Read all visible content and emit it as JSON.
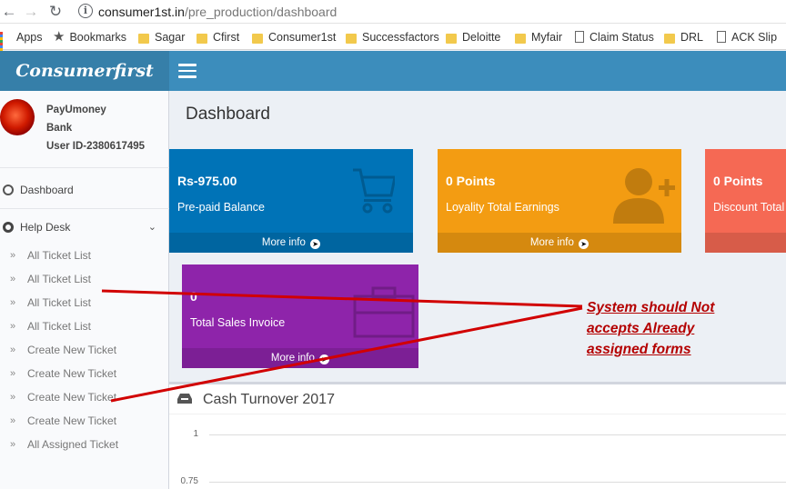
{
  "browser": {
    "url_host": "consumer1st.in",
    "url_path": "/pre_production/dashboard",
    "bookmarks": [
      {
        "label": "Apps",
        "icon": "apps-grid-icon"
      },
      {
        "label": "Bookmarks",
        "icon": "star-icon"
      },
      {
        "label": "Sagar",
        "icon": "folder-icon"
      },
      {
        "label": "Cfirst",
        "icon": "folder-icon"
      },
      {
        "label": "Consumer1st",
        "icon": "folder-icon"
      },
      {
        "label": "Successfactors",
        "icon": "folder-icon"
      },
      {
        "label": "Deloitte",
        "icon": "folder-icon"
      },
      {
        "label": "Myfair",
        "icon": "folder-icon"
      },
      {
        "label": "Claim Status",
        "icon": "page-icon"
      },
      {
        "label": "DRL",
        "icon": "folder-icon"
      },
      {
        "label": "ACK Slip",
        "icon": "page-icon"
      }
    ]
  },
  "app": {
    "logo": "Consumerfirst",
    "brand_color": "#3c8dbc"
  },
  "user": {
    "name": "PayUmoney",
    "type": "Bank",
    "id_label": "User ID-2380617495"
  },
  "sidebar": {
    "dashboard": "Dashboard",
    "helpdesk": "Help Desk",
    "items": [
      "All Ticket List",
      "All Ticket List",
      "All Ticket List",
      "All Ticket List",
      "Create New Ticket",
      "Create New Ticket",
      "Create New Ticket",
      "Create New Ticket",
      "All Assigned Ticket"
    ]
  },
  "page": {
    "title": "Dashboard"
  },
  "boxes": {
    "prepaid": {
      "amount": "Rs-975.00",
      "label": "Pre-paid Balance",
      "more": "More info",
      "color": "#0073b7"
    },
    "loyalty": {
      "amount": "0 Points",
      "label": "Loyality Total Earnings",
      "more": "More info",
      "color": "#f39c12"
    },
    "discount": {
      "amount": "0 Points",
      "label": "Discount Total",
      "color": "#f56954"
    },
    "sales": {
      "amount": "0",
      "label": "Total Sales Invoice",
      "more": "More info",
      "color": "#8e24aa"
    }
  },
  "chart_panel": {
    "title": "Cash Turnover 2017",
    "ticks": [
      "1",
      "0.75"
    ]
  },
  "annotation": {
    "lines": [
      "System should Not",
      "accepts Already",
      "assigned forms"
    ],
    "color": "#b40000"
  }
}
